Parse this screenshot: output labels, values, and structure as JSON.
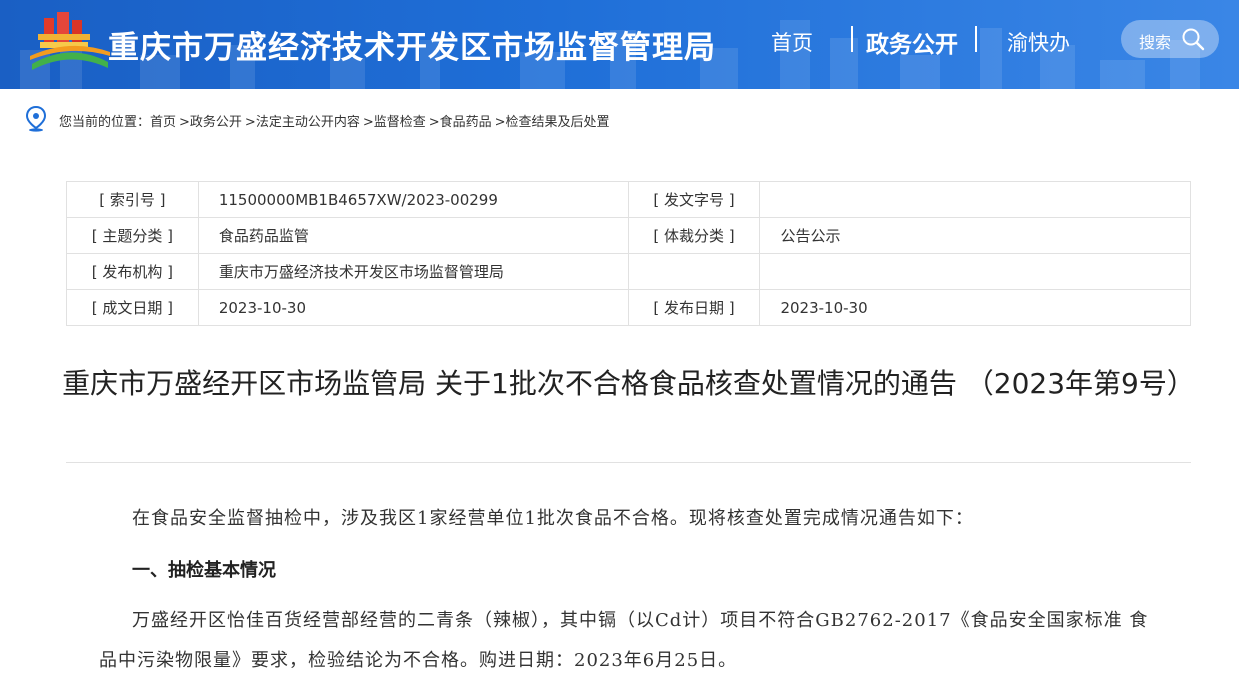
{
  "header": {
    "site_title": "重庆市万盛经济技术开发区市场监督管理局",
    "nav": [
      "首页",
      "政务公开",
      "渝快办"
    ],
    "search_label": "搜索"
  },
  "breadcrumb": {
    "prefix": "您当前的位置：",
    "items": [
      "首页",
      ">政务公开",
      ">法定主动公开内容",
      ">监督检查",
      ">食品药品",
      ">检查结果及后处置"
    ]
  },
  "meta": {
    "index_label": "[ 索引号 ]",
    "index_value": "11500000MB1B4657XW/2023-00299",
    "docno_label": "[ 发文字号 ]",
    "docno_value": "",
    "topic_label": "[ 主题分类 ]",
    "topic_value": "食品药品监管",
    "genre_label": "[ 体裁分类 ]",
    "genre_value": "公告公示",
    "publisher_label": "[ 发布机构 ]",
    "publisher_value": "重庆市万盛经济技术开发区市场监督管理局",
    "written_label": "[ 成文日期 ]",
    "written_value": "2023-10-30",
    "published_label": "[ 发布日期 ]",
    "published_value": "2023-10-30"
  },
  "doc": {
    "title": "重庆市万盛经开区市场监管局 关于1批次不合格食品核查处置情况的通告 （2023年第9号）",
    "p1": "在食品安全监督抽检中，涉及我区1家经营单位1批次食品不合格。现将核查处置完成情况通告如下：",
    "h1": "一、抽检基本情况",
    "p2": "万盛经开区怡佳百货经营部经营的二青条（辣椒），其中镉（以Cd计）项目不符合GB2762-2017《食品安全国家标准 食品中污染物限量》要求，检验结论为不合格。购进日期：2023年6月25日。"
  },
  "colors": {
    "header_blue": "#1f6fd8",
    "border": "#e1e1e1"
  }
}
